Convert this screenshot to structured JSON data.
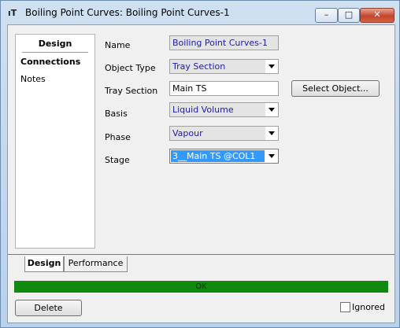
{
  "window": {
    "title_icon": "ıT",
    "title": "Boiling Point Curves: Boiling Point Curves-1",
    "min_glyph": "–",
    "max_glyph": "□",
    "close_glyph": "✕"
  },
  "sidebar": {
    "header": "Design",
    "items": [
      "Connections",
      "Notes"
    ]
  },
  "form": {
    "name_label": "Name",
    "name_value": "Boiling Point Curves-1",
    "object_type_label": "Object Type",
    "object_type_value": "Tray Section",
    "tray_section_label": "Tray Section",
    "tray_section_value": "Main TS",
    "basis_label": "Basis",
    "basis_value": "Liquid Volume",
    "phase_label": "Phase",
    "phase_value": "Vapour",
    "stage_label": "Stage",
    "stage_value": "3__Main TS @COL1",
    "select_object_label": "Select Object..."
  },
  "tabs": [
    "Design",
    "Performance"
  ],
  "status": {
    "text": "OK",
    "color": "#0f8a0f"
  },
  "footer": {
    "delete_label": "Delete",
    "ignored_label": "Ignored",
    "ignored_checked": false
  }
}
